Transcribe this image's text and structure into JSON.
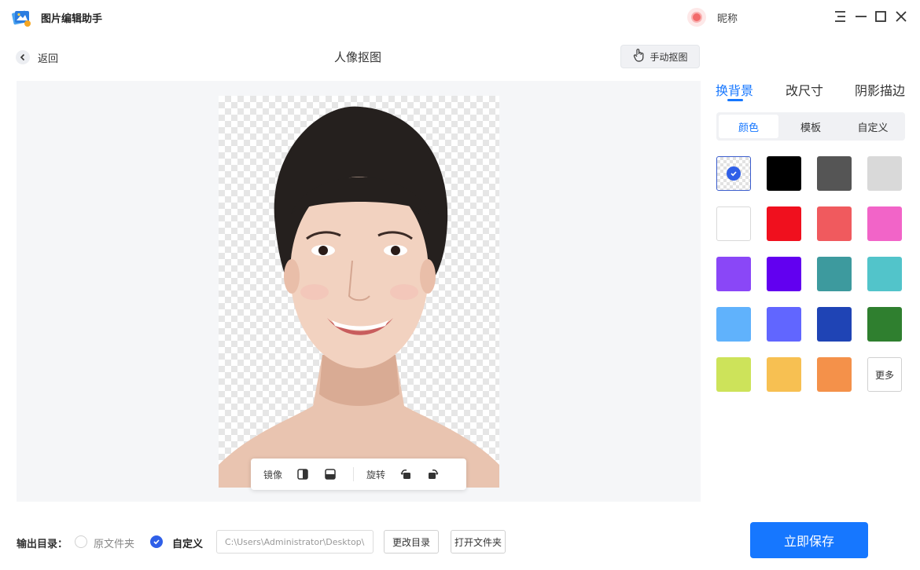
{
  "app": {
    "title": "图片编辑助手",
    "logo_icon": "image-editor-logo-icon",
    "user_nickname": "昵称"
  },
  "window_controls": [
    "menu-icon",
    "minimize-icon",
    "maximize-icon",
    "close-icon"
  ],
  "header": {
    "back_label": "返回",
    "page_title": "人像抠图",
    "manual_cutout_label": "手动抠图"
  },
  "image_toolbar": {
    "mirror_label": "镜像",
    "rotate_label": "旋转",
    "icons": [
      "flip-horizontal-icon",
      "flip-vertical-icon",
      "rotate-left-icon",
      "rotate-right-icon"
    ]
  },
  "side_panel": {
    "tabs": [
      {
        "label": "换背景",
        "active": true
      },
      {
        "label": "改尺寸",
        "active": false
      },
      {
        "label": "阴影描边",
        "active": false
      }
    ],
    "segments": [
      {
        "label": "颜色",
        "active": true
      },
      {
        "label": "模板",
        "active": false
      },
      {
        "label": "自定义",
        "active": false
      }
    ],
    "colors": [
      "transparent",
      "#000000",
      "#555555",
      "#d9d9d9",
      "#ffffff",
      "#f0101e",
      "#f05a5e",
      "#f264c8",
      "#8a47f7",
      "#6200f0",
      "#3d9a9e",
      "#52c4ca",
      "#60b2fc",
      "#6166ff",
      "#1f44b5",
      "#2f7f2f",
      "#cde35a",
      "#f7c052",
      "#f4914a"
    ],
    "selected_color": "transparent",
    "more_label": "更多"
  },
  "footer": {
    "output_label": "输出目录：",
    "option_original": "原文件夹",
    "option_custom": "自定义",
    "selected_option": "custom",
    "path_value": "C:\\Users\\Administrator\\Desktop\\图",
    "change_dir_label": "更改目录",
    "open_folder_label": "打开文件夹",
    "save_label": "立即保存"
  },
  "accent_color": "#1677ff"
}
